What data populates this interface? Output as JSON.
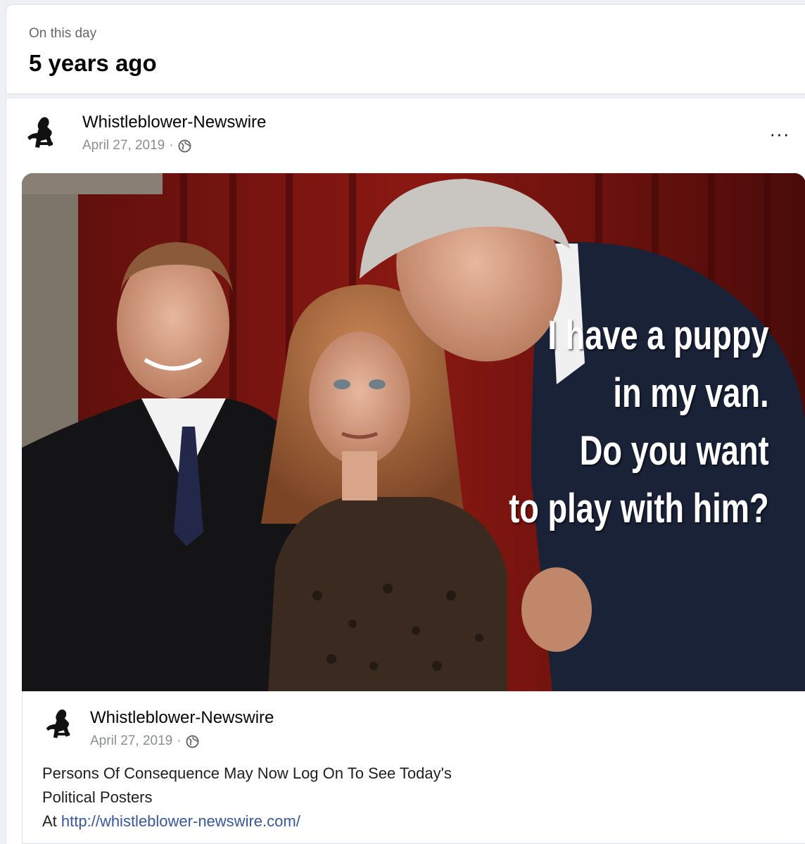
{
  "memories_header": {
    "kicker": "On this day",
    "title": "5 years ago"
  },
  "post": {
    "author": "Whistleblower-Newswire",
    "date": "April 27, 2019",
    "separator": "·",
    "privacy_icon": "globe-icon",
    "more_label": "···",
    "image_caption": {
      "line1": "I have a puppy",
      "line2": "in my van.",
      "line3": "Do you want",
      "line4": "to play with him?"
    }
  },
  "shared_post": {
    "author": "Whistleblower-Newswire",
    "date": "April 27, 2019",
    "separator": "·",
    "privacy_icon": "globe-icon",
    "text_line1": "Persons Of Consequence May Now Log On To See Today's",
    "text_line2": "Political Posters",
    "text_prefix": "At ",
    "link": "http://whistleblower-newswire.com/"
  },
  "colors": {
    "link": "#385898",
    "meta_gray": "#8a8d91",
    "curtain_red": "#7a1410"
  }
}
